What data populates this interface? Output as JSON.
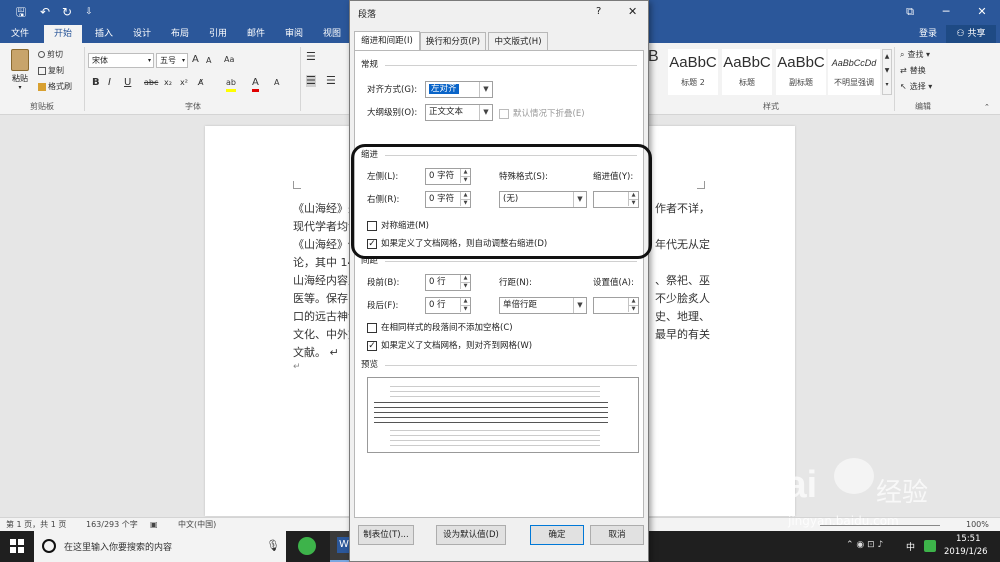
{
  "quick_access": {
    "save_glyph": "🖫",
    "undo_glyph": "↶",
    "redo_glyph": "↻",
    "more_glyph": "⇩"
  },
  "window": {
    "ribbon_glyph": "⧉",
    "min_glyph": "─",
    "max_glyph": "☐",
    "close_glyph": "✕"
  },
  "ribbon_tabs": [
    "文件",
    "开始",
    "插入",
    "设计",
    "布局",
    "引用",
    "邮件",
    "审阅",
    "视图"
  ],
  "account": {
    "login": "登录",
    "share": "共享"
  },
  "clipboard": {
    "paste": "粘贴",
    "cut": "剪切",
    "copy": "复制",
    "format_painter": "格式刷",
    "group": "剪贴板"
  },
  "font": {
    "name": "宋体",
    "size": "五号",
    "grow": "A",
    "shrink": "A",
    "group": "字体",
    "bold": "B",
    "italic": "I",
    "underline": "U",
    "strike": "abc",
    "sub": "x₂",
    "sup": "x²"
  },
  "styles": {
    "items": [
      {
        "preview": "AaBbC",
        "name": "标题 2"
      },
      {
        "preview": "AaBbC",
        "name": "标题"
      },
      {
        "preview": "AaBbC",
        "name": "副标题"
      },
      {
        "preview": "AaBbCcDd",
        "name": "不明显强调"
      }
    ],
    "partial": "B",
    "group": "样式"
  },
  "editing": {
    "find": "查找",
    "replace": "替换",
    "select": "选择",
    "group": "编辑"
  },
  "document_lines": [
    "《山海经》是",
    "现代学者均认",
    "《山海经》传",
    "论，其中 14",
    "山海经内容主",
    "医等。保存了",
    "口的远古神话",
    "文化、中外文",
    "文献。 ↵",
    "↵"
  ],
  "document_lines_right": [
    "作者不详，",
    "",
    "年代无从定",
    "",
    "、祭祀、巫",
    "不少脍炙人",
    "史、地理、",
    "最早的有关",
    "",
    ""
  ],
  "status": {
    "page": "第 1 页，共 1 页",
    "words": "163/293 个字",
    "lang": "中文(中国)",
    "zoom": "100%"
  },
  "taskbar": {
    "search_placeholder": "在这里输入你要搜索的内容",
    "time": "15:51",
    "date": "2019/1/26",
    "input": "中",
    "word_app": "W"
  },
  "watermark": {
    "brand": "Bai",
    "brand2": "经验",
    "url": "jingyan.baidu.com"
  },
  "dialog": {
    "title": "段落",
    "help": "?",
    "close": "✕",
    "tabs": [
      "缩进和间距(I)",
      "换行和分页(P)",
      "中文版式(H)"
    ],
    "general": {
      "heading": "常规",
      "align_label": "对齐方式(G):",
      "align_value": "左对齐",
      "outline_label": "大纲级别(O):",
      "outline_value": "正文文本",
      "collapse_label": "默认情况下折叠(E)"
    },
    "indent": {
      "heading": "缩进",
      "left_label": "左侧(L):",
      "left_value": "0 字符",
      "right_label": "右侧(R):",
      "right_value": "0 字符",
      "special_label": "特殊格式(S):",
      "special_value": "(无)",
      "by_label": "缩进值(Y):",
      "mirror_label": "对称缩进(M)",
      "auto_label": "如果定义了文档网格，则自动调整右缩进(D)"
    },
    "spacing": {
      "heading": "间距",
      "before_label": "段前(B):",
      "before_value": "0 行",
      "after_label": "段后(F):",
      "after_value": "0 行",
      "line_label": "行距(N):",
      "line_value": "单倍行距",
      "at_label": "设置值(A):",
      "nospace_label": "在相同样式的段落间不添加空格(C)",
      "grid_label": "如果定义了文档网格，则对齐到网格(W)"
    },
    "preview": {
      "heading": "预览"
    },
    "buttons": {
      "tabs": "制表位(T)...",
      "default": "设为默认值(D)",
      "ok": "确定",
      "cancel": "取消"
    }
  }
}
